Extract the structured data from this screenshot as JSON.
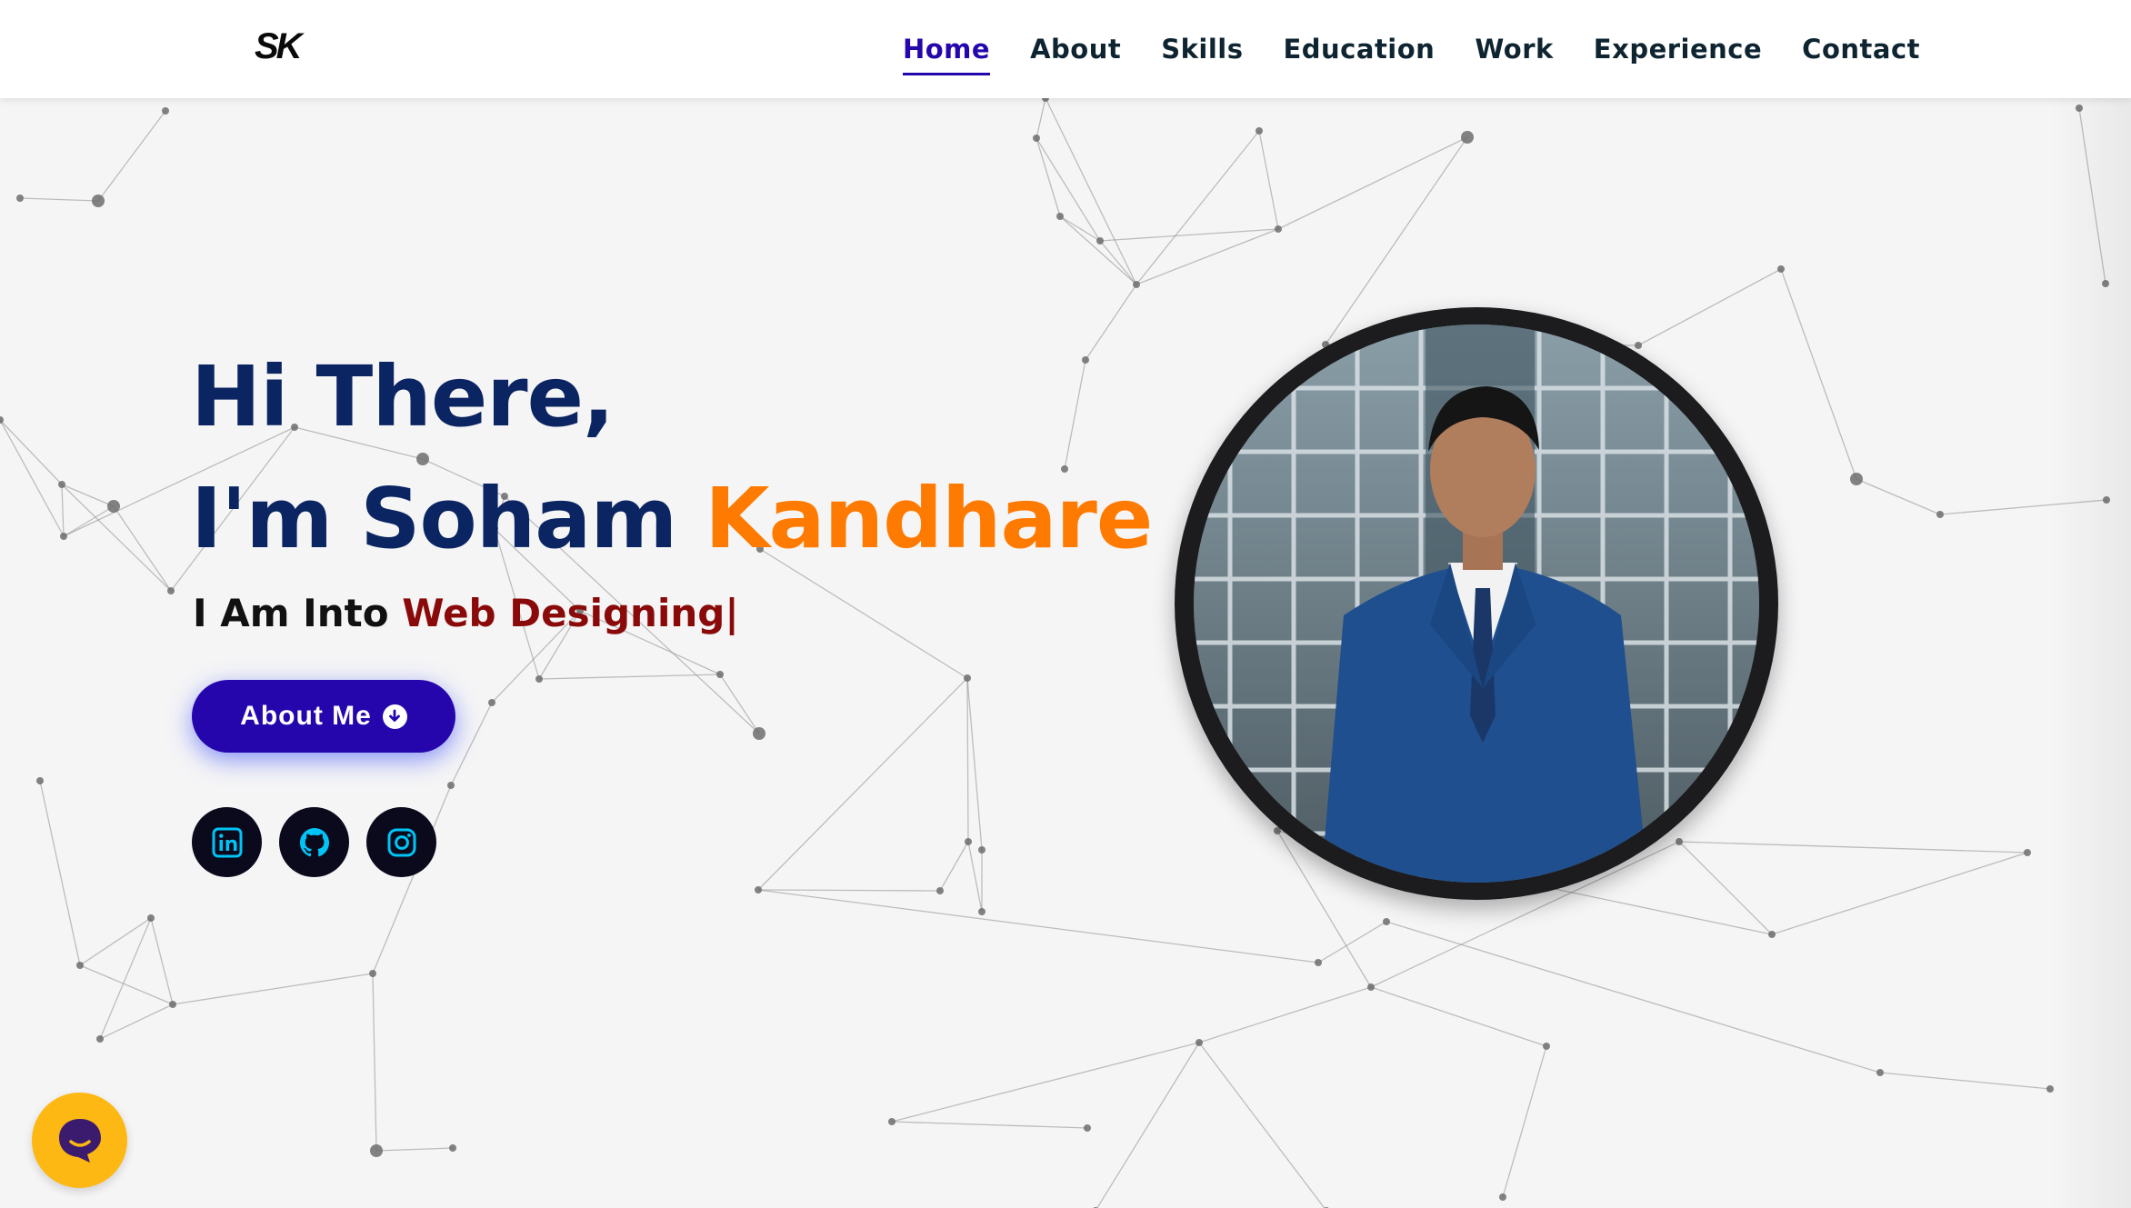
{
  "brand": {
    "logo_text": "SK"
  },
  "nav": {
    "items": [
      {
        "label": "Home",
        "active": true
      },
      {
        "label": "About"
      },
      {
        "label": "Skills"
      },
      {
        "label": "Education"
      },
      {
        "label": "Work"
      },
      {
        "label": "Experience"
      },
      {
        "label": "Contact"
      }
    ]
  },
  "hero": {
    "greeting": "Hi There,",
    "intro": "I'm Soham ",
    "name_highlight": "Kandhare",
    "subline_prefix": "I Am Into ",
    "typed_text": "Web Designing",
    "cursor": "|",
    "cta_label": "About Me",
    "cta_icon": "arrow-down-circle-icon"
  },
  "socials": [
    "linkedin-icon",
    "github-icon",
    "instagram-icon"
  ],
  "chat": {
    "icon": "chat-bubble-icon"
  },
  "colors": {
    "nav_active": "#2506ad",
    "heading": "#0b2562",
    "name_highlight": "#ff7a00",
    "typed_text": "#8a0a0a",
    "cta_bg": "#2506ad",
    "social_bg": "#0a0a1c",
    "social_icon": "#00c4f5",
    "chat_bg": "#fdb813"
  }
}
